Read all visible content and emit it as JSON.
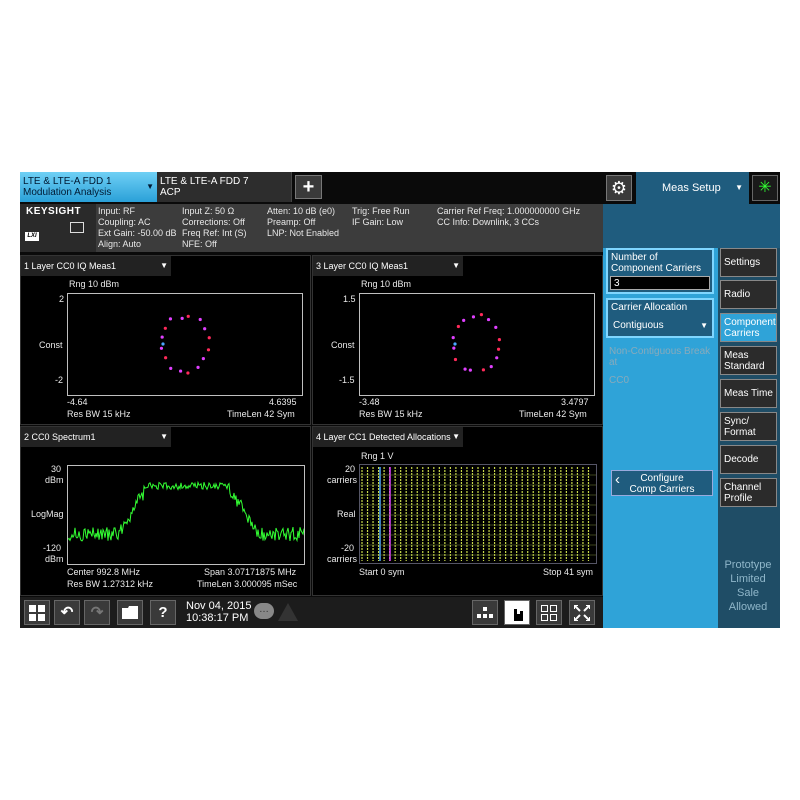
{
  "tabs": [
    {
      "line1": "LTE & LTE-A FDD 1",
      "line2": "Modulation Analysis"
    },
    {
      "line1": "LTE & LTE-A FDD 7",
      "line2": "ACP"
    }
  ],
  "add_tab_label": "+",
  "brand": "KEYSIGHT",
  "lxi_label": "LXI",
  "info": {
    "col1": [
      "Input: RF",
      "Coupling: AC",
      "Ext Gain: -50.00 dB",
      "Align: Auto"
    ],
    "col2": [
      "Input Z: 50 Ω",
      "Corrections: Off",
      "Freq Ref: Int (S)",
      "NFE: Off"
    ],
    "col3": [
      "Atten: 10 dB (e0)",
      "Preamp: Off",
      "LNP: Not Enabled"
    ],
    "col4": [
      "Trig: Free Run",
      "IF Gain: Low"
    ],
    "col5": [
      "Carrier Ref Freq: 1.000000000 GHz",
      "CC Info: Downlink, 3 CCs"
    ]
  },
  "panels": {
    "p1": {
      "title": "1 Layer CC0 IQ Meas1",
      "rng": "Rng 10 dBm",
      "ytop": "2",
      "ymid": "Const",
      "ybot": "-2",
      "xl": "-4.64",
      "xr": "4.6395",
      "bl": "Res BW 15 kHz",
      "br": "TimeLen 42  Sym"
    },
    "p3": {
      "title": "3 Layer CC0 IQ Meas1",
      "rng": "Rng 10 dBm",
      "ytop": "1.5",
      "ymid": "Const",
      "ybot": "-1.5",
      "xl": "-3.48",
      "xr": "3.4797",
      "bl": "Res BW 15 kHz",
      "br": "TimeLen 42  Sym"
    },
    "p2": {
      "title": "2 CC0 Spectrum1",
      "ytop1": "30",
      "ytop2": "dBm",
      "ymid": "LogMag",
      "ybot1": "-120",
      "ybot2": "dBm",
      "center": "Center 992.8 MHz",
      "span": "Span 3.07171875 MHz",
      "resbw": "Res BW 1.27312 kHz",
      "timelen": "TimeLen 3.000095 mSec"
    },
    "p4": {
      "title": "4 Layer CC1 Detected Allocations",
      "rng": "Rng 1  V",
      "ytop1": "20",
      "ytop2": "carriers",
      "ymid": "Real",
      "ybot1": "-20",
      "ybot2": "carriers",
      "start": "Start 0  sym",
      "stop": "Stop 41  sym"
    }
  },
  "datetime": {
    "date": "Nov 04, 2015",
    "time": "10:38:17 PM"
  },
  "meas_setup": "Meas Setup",
  "menu": {
    "num_cc_label": "Number of Component Carriers",
    "num_cc_value": "3",
    "carrier_alloc_label": "Carrier Allocation",
    "carrier_alloc_value": "Contiguous",
    "noncontig_label": "Non-Contiguous Break at",
    "noncontig_value": "CC0",
    "configure_label1": "Configure",
    "configure_label2": "Comp Carriers"
  },
  "side_buttons": [
    {
      "l1": "Settings",
      "l2": ""
    },
    {
      "l1": "Radio",
      "l2": ""
    },
    {
      "l1": "Component",
      "l2": "Carriers"
    },
    {
      "l1": "Meas",
      "l2": "Standard"
    },
    {
      "l1": "Meas Time",
      "l2": ""
    },
    {
      "l1": "Sync/",
      "l2": "Format"
    },
    {
      "l1": "Decode",
      "l2": ""
    },
    {
      "l1": "Channel",
      "l2": "Profile"
    }
  ],
  "watermark": [
    "Prototype",
    "Limited",
    "Sale",
    "Allowed"
  ],
  "colors": {
    "accent": "#2fa3d8",
    "spectrum": "#33ff33",
    "const_red": "#ff2a5a",
    "const_magenta": "#e040ff"
  }
}
